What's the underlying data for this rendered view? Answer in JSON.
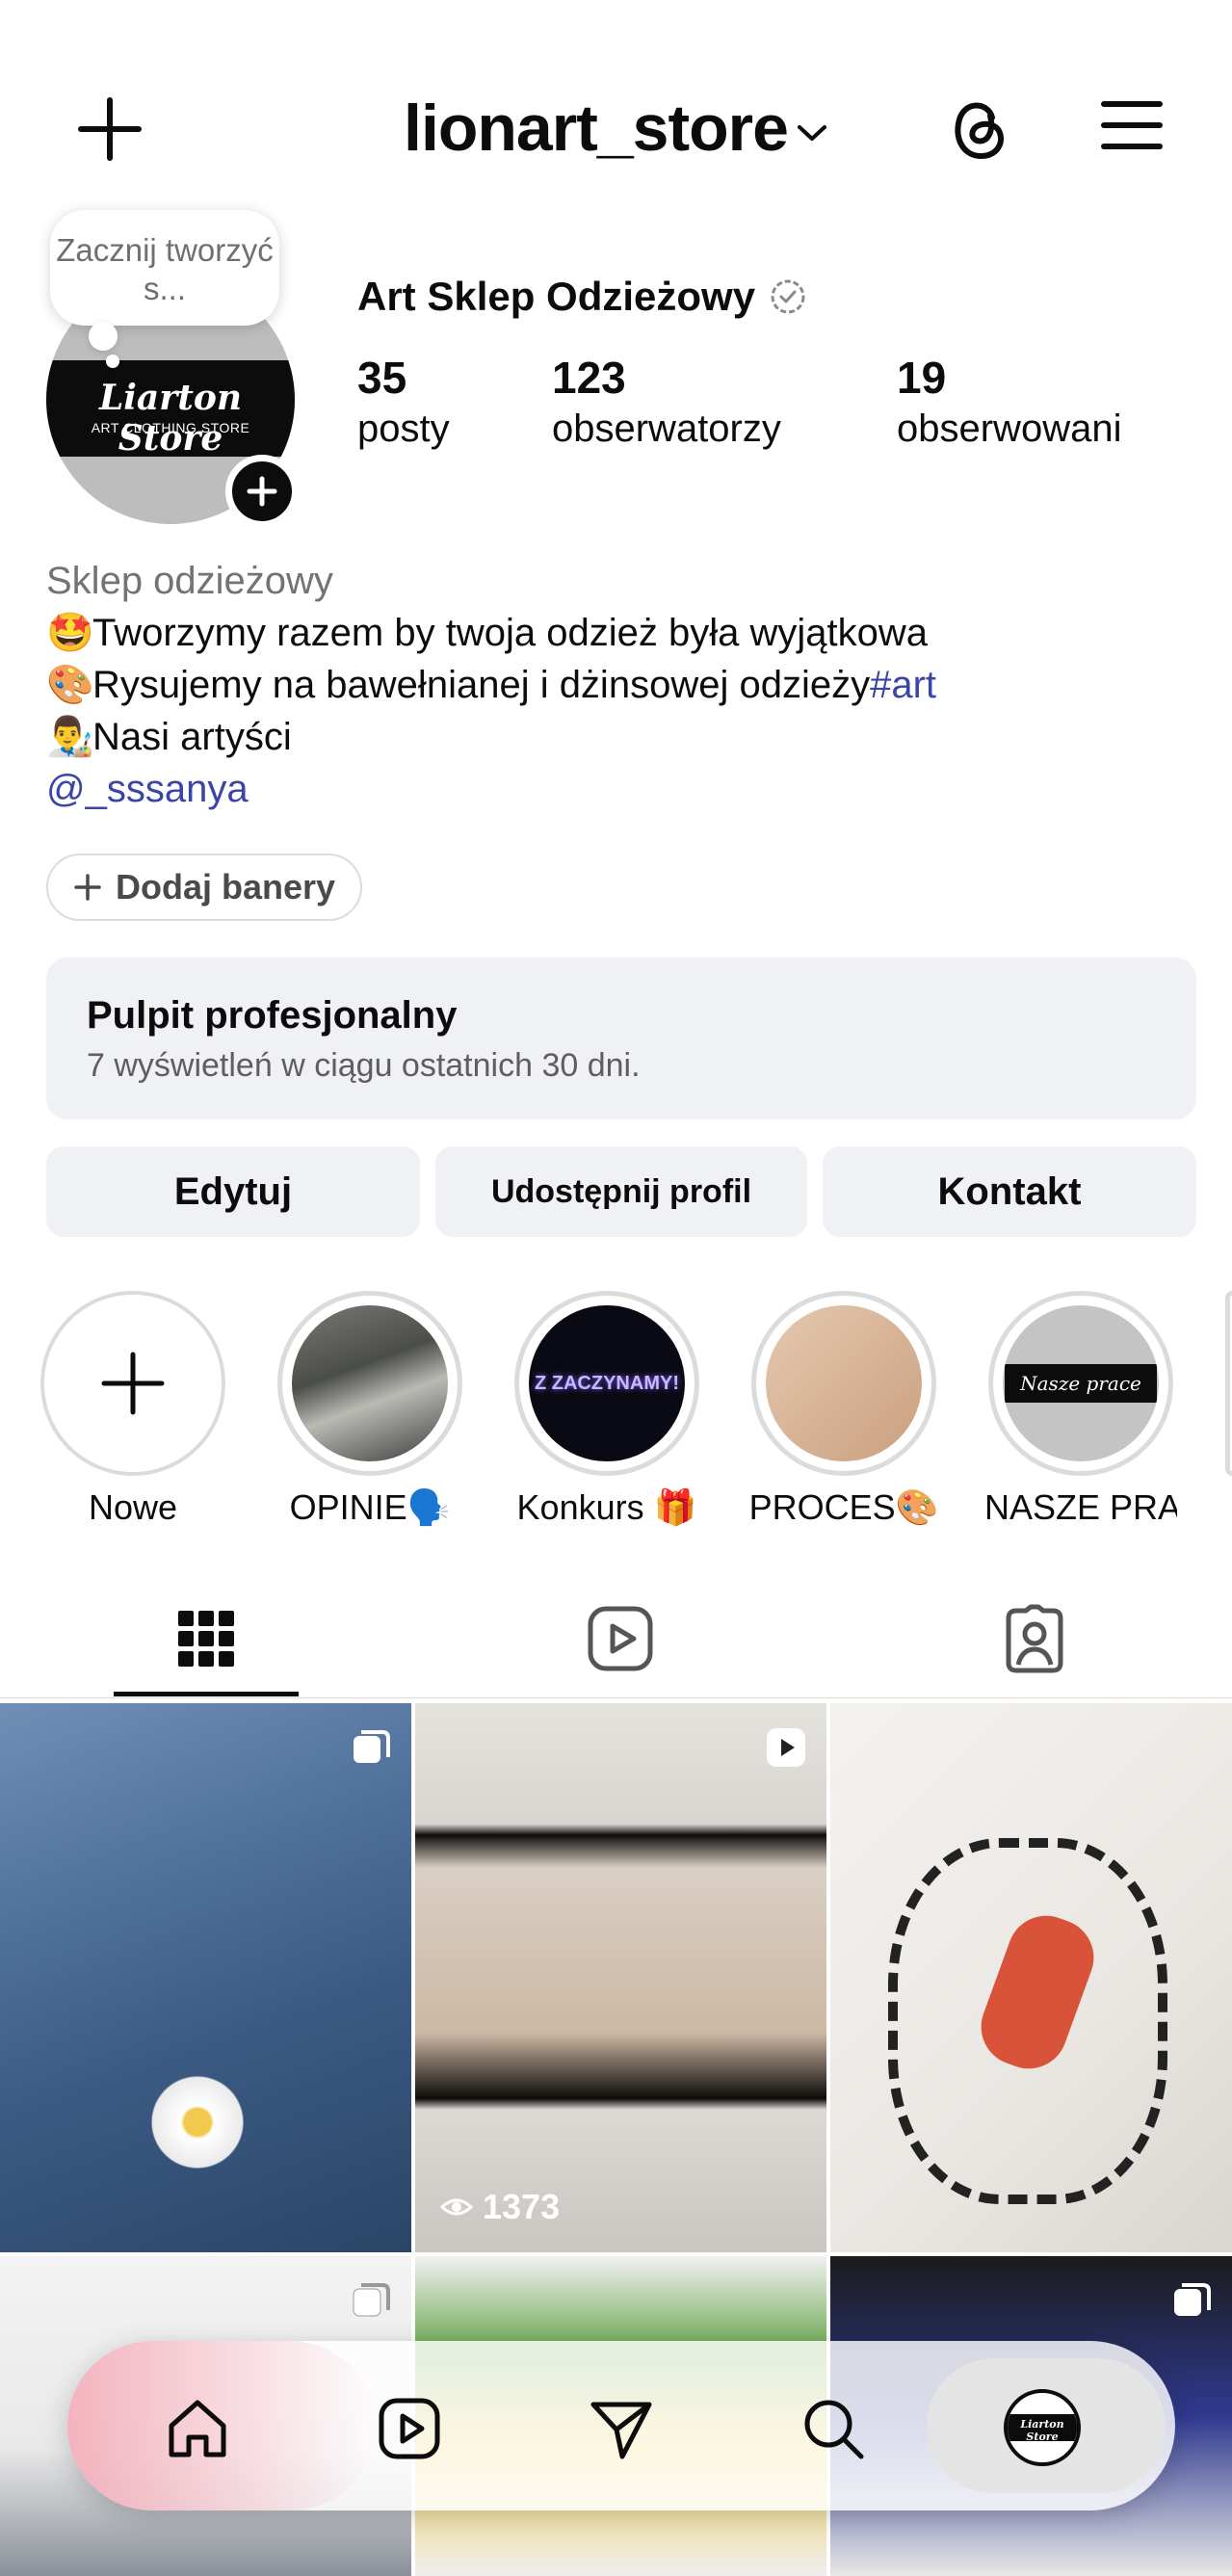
{
  "header": {
    "username": "lionart_store"
  },
  "note": {
    "text": "Zacznij tworzyć s..."
  },
  "avatar": {
    "logo_text": "Liarton Store",
    "logo_sub": "ART CLOTHING STORE"
  },
  "profile": {
    "name": "Art Sklep Odzieżowy",
    "stats": [
      {
        "value": "35",
        "label": "posty"
      },
      {
        "value": "123",
        "label": "obserwatorzy"
      },
      {
        "value": "19",
        "label": "obserwowani"
      }
    ]
  },
  "bio": {
    "category": "Sklep odzieżowy",
    "line1_emoji": "🤩",
    "line1_text": "Tworzymy razem by twoja odzież była wyjątkowa",
    "line2_emoji": "🎨",
    "line2_text": "Rysujemy na bawełnianej i dżinsowej odzieży",
    "line2_hashtag": "#art",
    "line3_emoji": "👨‍🎨",
    "line3_text": "Nasi artyści",
    "mention": "@_sssanya"
  },
  "banner_button": "Dodaj banery",
  "dashboard": {
    "title": "Pulpit profesjonalny",
    "subtitle": "7 wyświetleń w ciągu ostatnich 30 dni."
  },
  "actions": {
    "edit": "Edytuj",
    "share": "Udostępnij profil",
    "contact": "Kontakt"
  },
  "highlights": [
    {
      "label": "Nowe"
    },
    {
      "label": "OPINIE🗣️"
    },
    {
      "label": "Konkurs 🎁",
      "cover_text": "Z ZACZYNAMY!"
    },
    {
      "label": "PROCES🎨"
    },
    {
      "label": "NASZE PRA...",
      "cover_text": "Nasze prace"
    }
  ],
  "grid": {
    "views": "1373"
  },
  "colors": {
    "link": "#3a45a8",
    "button_bg": "#eff1f5",
    "text": "#0c0c0c",
    "muted": "#737373"
  }
}
